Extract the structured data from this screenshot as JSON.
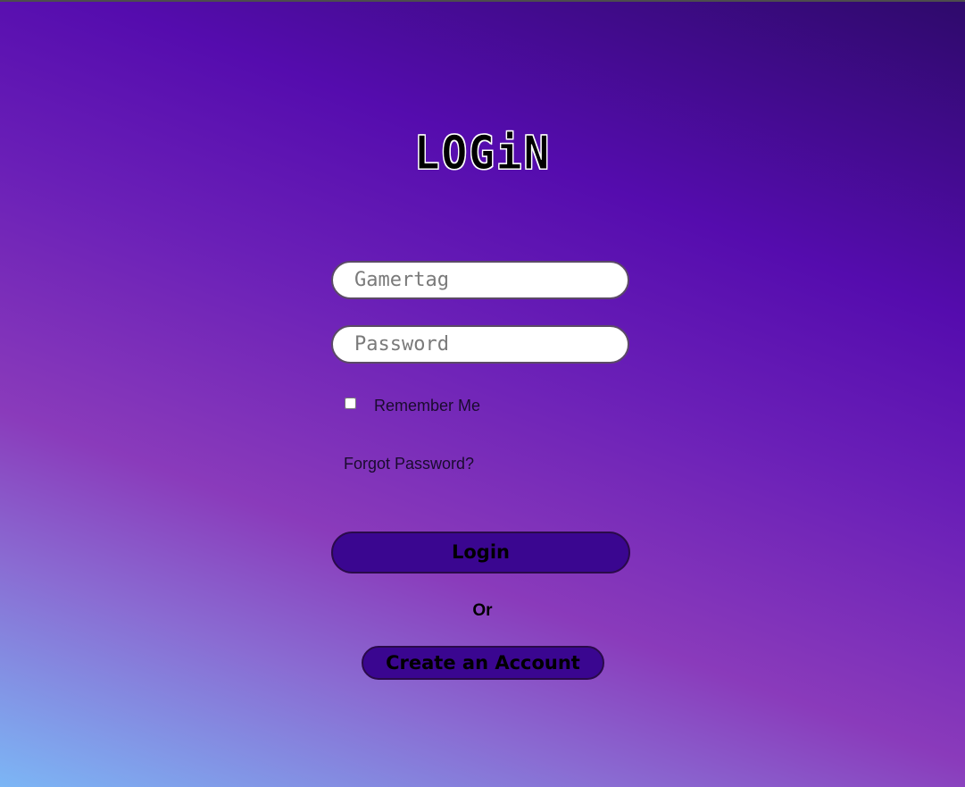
{
  "page": {
    "title": "LOGiN"
  },
  "form": {
    "gamertag_placeholder": "Gamertag",
    "password_placeholder": "Password",
    "remember_label": "Remember Me",
    "remember_checked": false,
    "forgot_label": "Forgot Password?",
    "login_label": "Login",
    "or_label": "Or",
    "create_label": "Create an Account"
  },
  "colors": {
    "button_bg": "#3a0690",
    "gradient_top_right": "#2e0a6b",
    "gradient_mid": "#550cae",
    "gradient_bottom_left": "#7cb6f5"
  }
}
